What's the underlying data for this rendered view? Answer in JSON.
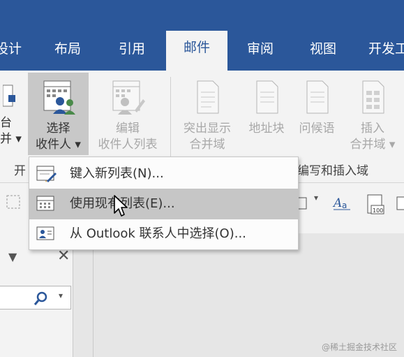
{
  "tabs": [
    "设计",
    "布局",
    "引用",
    "邮件",
    "审阅",
    "视图",
    "开发工"
  ],
  "active_tab": "邮件",
  "ribbon": {
    "partial_btn_line1": "台",
    "partial_btn_line2": "并 ▾",
    "select_recipients": {
      "line1": "选择",
      "line2": "收件人 ▾"
    },
    "edit_recipients": {
      "line1": "编辑",
      "line2": "收件人列表"
    },
    "highlight_merge": {
      "line1": "突出显示",
      "line2": "合并域"
    },
    "address_block": "地址块",
    "greeting_line": "问候语",
    "insert_merge": {
      "line1": "插入",
      "line2": "合并域 ▾"
    },
    "group_left_label": "开",
    "group_write_insert": "编写和插入域"
  },
  "menu": {
    "items": [
      {
        "label": "键入新列表(N)...",
        "icon": "new-list-icon"
      },
      {
        "label": "使用现有列表(E)...",
        "icon": "existing-list-icon",
        "hover": true
      },
      {
        "label": "从 Outlook 联系人中选择(O)...",
        "icon": "outlook-contacts-icon"
      }
    ]
  },
  "watermark": "@稀土掘金技术社区",
  "colors": {
    "ribbon_blue": "#2b579a",
    "hover_gray": "#c6c6c6"
  }
}
